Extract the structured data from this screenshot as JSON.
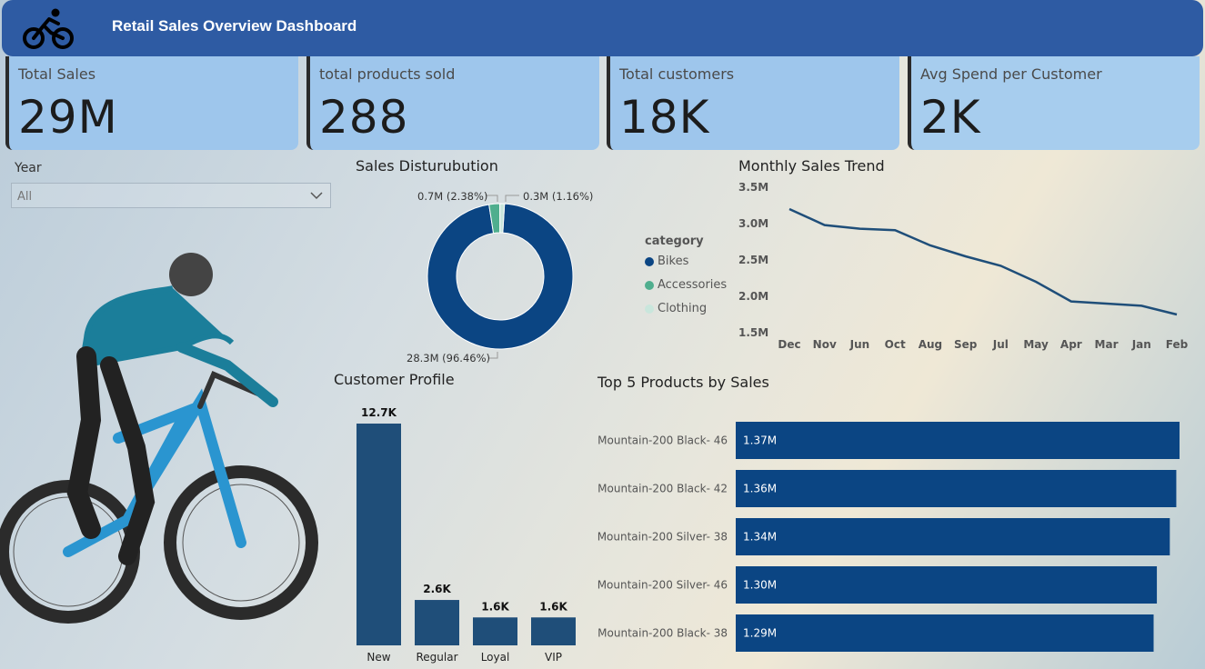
{
  "header": {
    "title": "Retail Sales Overview Dashboard",
    "logo_icon": "bicycle-icon"
  },
  "kpis": [
    {
      "label": "Total Sales",
      "value": "29M"
    },
    {
      "label": "total products sold",
      "value": "288"
    },
    {
      "label": "Total customers",
      "value": "18K"
    },
    {
      "label": "Avg Spend per Customer",
      "value": "2K"
    }
  ],
  "slicer": {
    "label": "Year",
    "value": "All"
  },
  "donut": {
    "title": "Sales Disturubution",
    "legend_title": "category",
    "chart_data": {
      "type": "pie",
      "slices": [
        {
          "name": "Bikes",
          "value": 28.3,
          "label": "28.3M (96.46%)",
          "color": "#0b4583"
        },
        {
          "name": "Accessories",
          "value": 0.7,
          "label": "0.7M (2.38%)",
          "color": "#4fae8e"
        },
        {
          "name": "Clothing",
          "value": 0.3,
          "label": "0.3M (1.16%)",
          "color": "#c9e6dc"
        }
      ]
    }
  },
  "trend": {
    "title": "Monthly Sales Trend",
    "chart_data": {
      "type": "line",
      "categories": [
        "Dec",
        "Nov",
        "Jun",
        "Oct",
        "Aug",
        "Sep",
        "Jul",
        "May",
        "Apr",
        "Mar",
        "Jan",
        "Feb"
      ],
      "values": [
        3.2,
        2.98,
        2.93,
        2.91,
        2.7,
        2.55,
        2.42,
        2.2,
        1.93,
        1.9,
        1.87,
        1.75
      ],
      "yticks": [
        "3.5M",
        "3.0M",
        "2.5M",
        "2.0M",
        "1.5M"
      ],
      "ylim": [
        1.5,
        3.5
      ],
      "color": "#1f4e79"
    }
  },
  "profile": {
    "title": "Customer Profile",
    "chart_data": {
      "type": "bar",
      "categories": [
        "New",
        "Regular",
        "Loyal",
        "VIP"
      ],
      "values": [
        12.7,
        2.6,
        1.6,
        1.6
      ],
      "labels": [
        "12.7K",
        "2.6K",
        "1.6K",
        "1.6K"
      ],
      "color": "#1f4e79"
    }
  },
  "top5": {
    "title": "Top 5 Products by Sales",
    "chart_data": {
      "type": "bar",
      "orientation": "horizontal",
      "categories": [
        "Mountain-200 Black- 46",
        "Mountain-200 Black- 42",
        "Mountain-200 Silver- 38",
        "Mountain-200 Silver- 46",
        "Mountain-200 Black- 38"
      ],
      "values": [
        1.37,
        1.36,
        1.34,
        1.3,
        1.29
      ],
      "labels": [
        "1.37M",
        "1.36M",
        "1.34M",
        "1.30M",
        "1.29M"
      ],
      "color": "#0b4583"
    }
  }
}
